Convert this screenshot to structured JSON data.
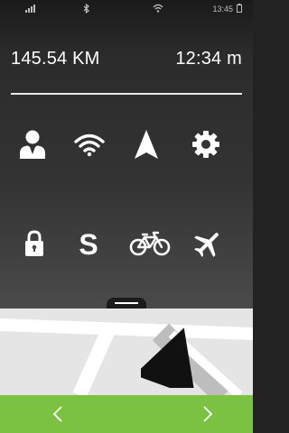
{
  "status_bar": {
    "time": "13:45",
    "icons": [
      "signal-icon",
      "bluetooth-icon",
      "wifi-icon",
      "battery-icon"
    ]
  },
  "stats": {
    "distance": "145.54 KM",
    "duration": "12:34 m"
  },
  "quick_actions": [
    {
      "icon": "person-icon",
      "label": ""
    },
    {
      "icon": "wifi-icon",
      "label": ""
    },
    {
      "icon": "navigation-arrow-icon",
      "label": ""
    },
    {
      "icon": "gear-icon",
      "label": ""
    },
    {
      "icon": "lock-icon",
      "label": ""
    },
    {
      "icon": "s-icon",
      "label": ""
    },
    {
      "icon": "bicycle-icon",
      "label": ""
    },
    {
      "icon": "airplane-icon",
      "label": ""
    }
  ],
  "map": {
    "marker_icon": "navigation-arrow-icon"
  },
  "nav": {
    "prev_icon": "chevron-left-icon",
    "next_icon": "chevron-right-icon"
  },
  "colors": {
    "accent": "#7cc242",
    "panel_dark": "#1a1a1a",
    "map_bg": "#e5e5e5"
  }
}
